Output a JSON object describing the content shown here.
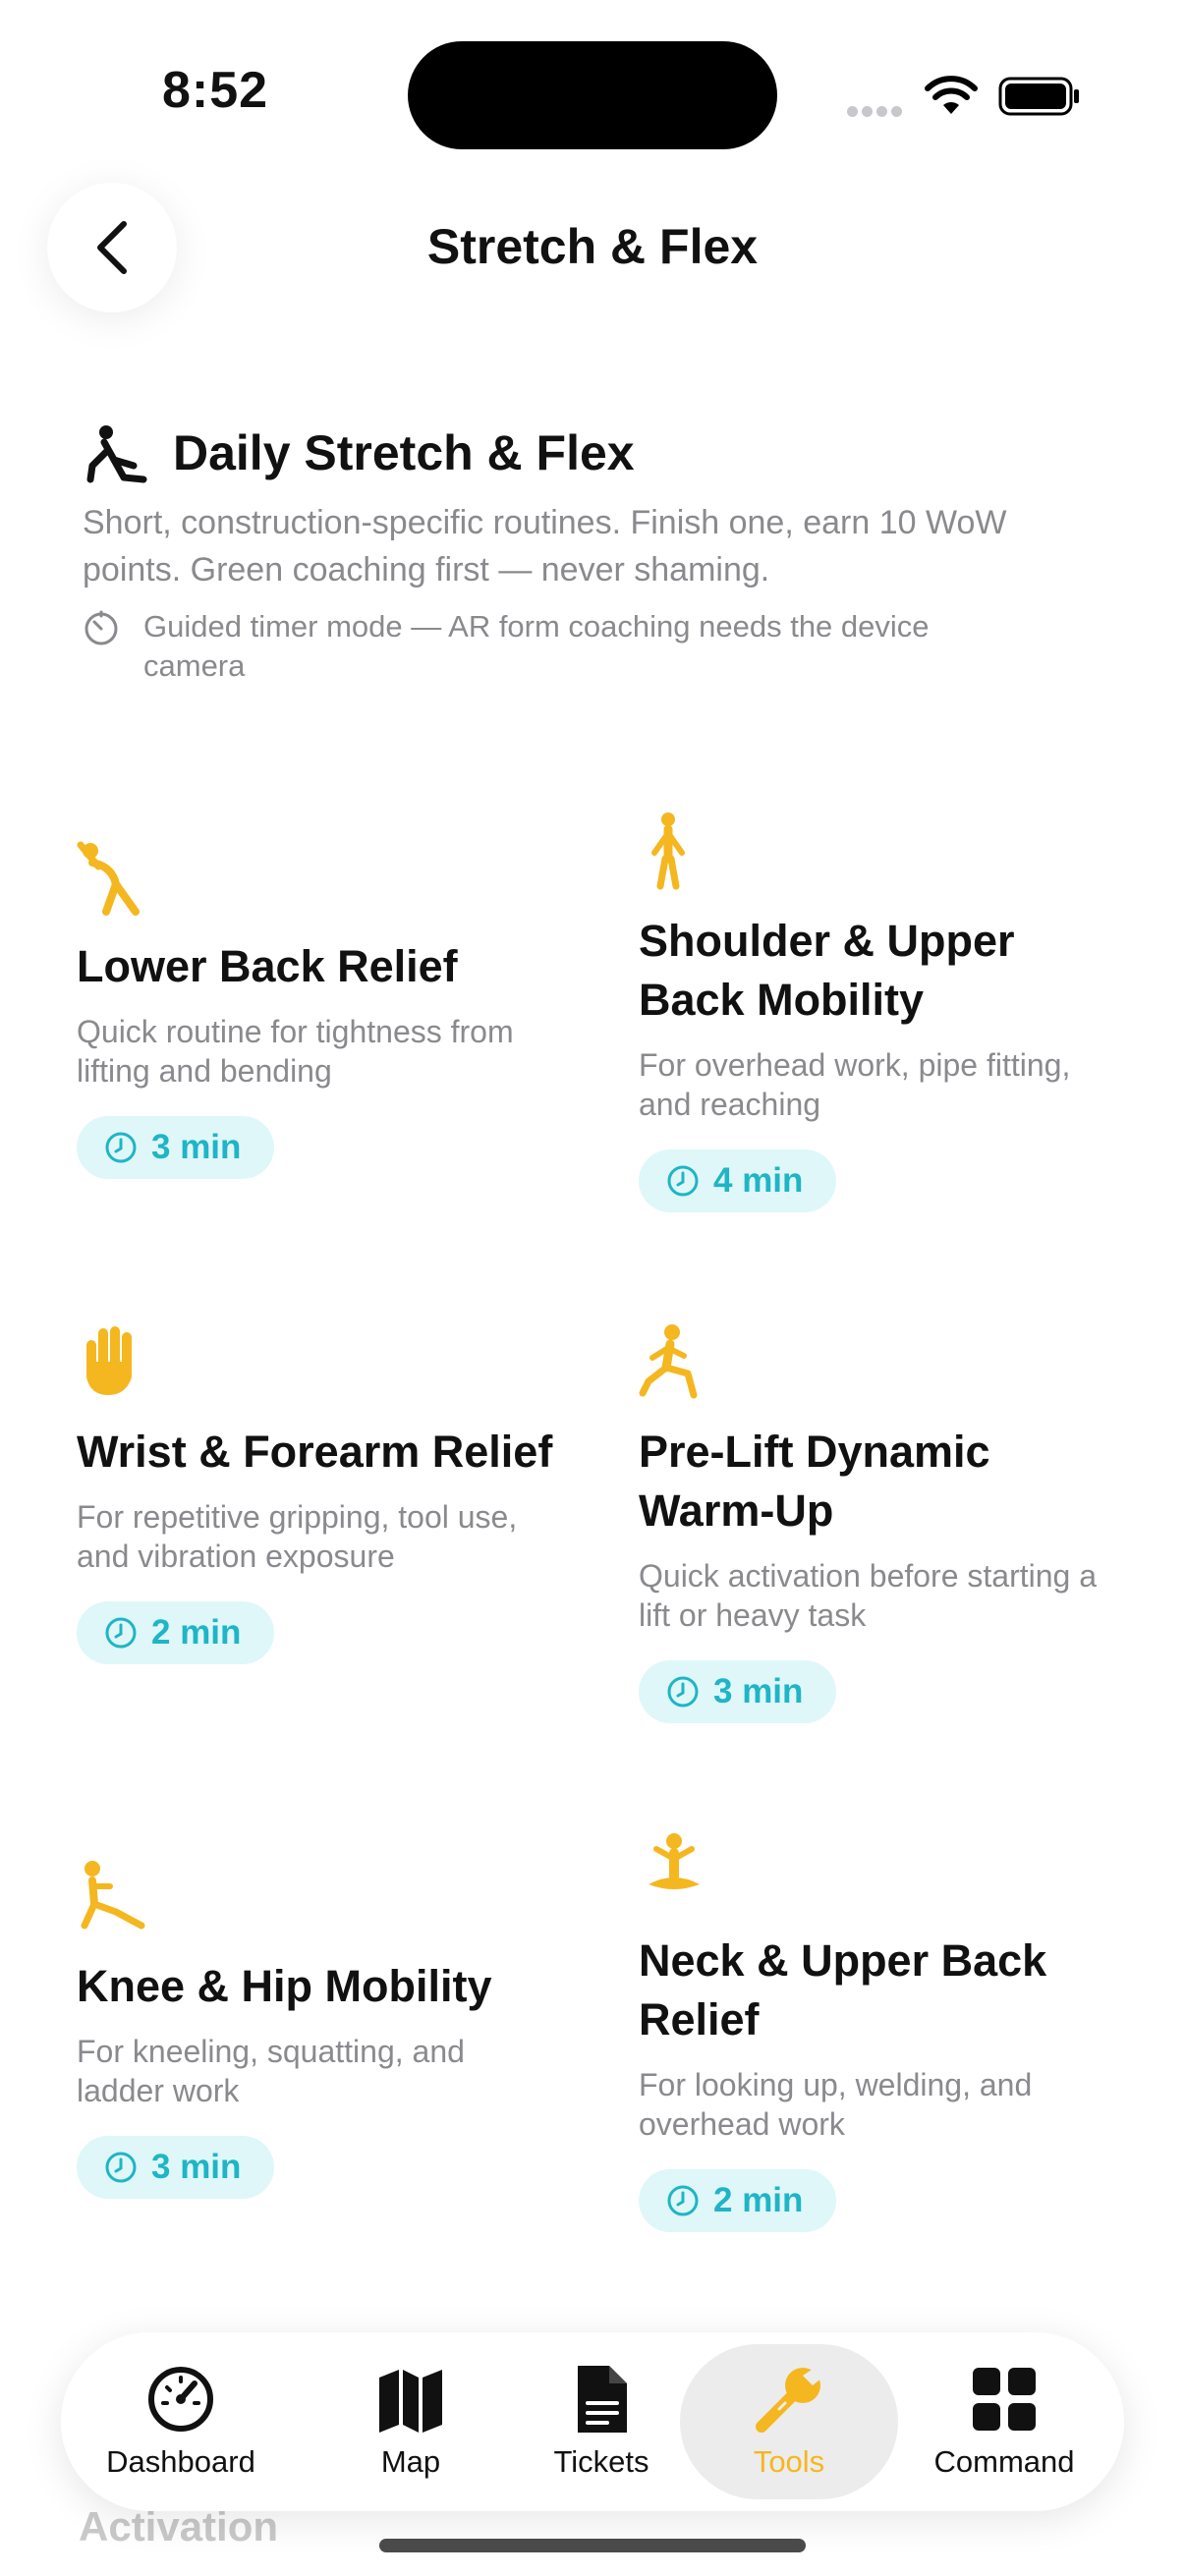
{
  "status_bar": {
    "time": "8:52"
  },
  "header": {
    "title": "Stretch & Flex"
  },
  "intro": {
    "heading": "Daily Stretch & Flex",
    "description": "Short, construction-specific routines. Finish one, earn 10 WoW points. Green coaching first — never shaming.",
    "note": "Guided timer mode — AR form coaching needs the device camera"
  },
  "routines": [
    {
      "title": "Lower Back Relief",
      "description": "Quick routine for tightness from lifting and bending",
      "duration": "3 min"
    },
    {
      "title": "Shoulder & Upper Back Mobility",
      "description": "For overhead work, pipe fitting, and reaching",
      "duration": "4 min"
    },
    {
      "title": "Wrist & Forearm Relief",
      "description": "For repetitive gripping, tool use, and vibration exposure",
      "duration": "2 min"
    },
    {
      "title": "Pre-Lift Dynamic Warm-Up",
      "description": "Quick activation before starting a lift or heavy task",
      "duration": "3 min"
    },
    {
      "title": "Knee & Hip Mobility",
      "description": "For kneeling, squatting, and ladder work",
      "duration": "3 min"
    },
    {
      "title": "Neck & Upper Back Relief",
      "description": "For looking up, welding, and overhead work",
      "duration": "2 min"
    }
  ],
  "peek_text": "Activation",
  "tab_bar": {
    "tabs": [
      {
        "label": "Dashboard",
        "icon": "gauge-icon"
      },
      {
        "label": "Map",
        "icon": "map-icon"
      },
      {
        "label": "Tickets",
        "icon": "document-icon"
      },
      {
        "label": "Tools",
        "icon": "wrench-icon",
        "active": true
      },
      {
        "label": "Command",
        "icon": "grid-icon"
      }
    ]
  },
  "colors": {
    "accent": "#f5b71f",
    "pill_bg": "#dff7f9",
    "pill_text": "#1fb5c6",
    "muted": "#8a8a8e"
  }
}
